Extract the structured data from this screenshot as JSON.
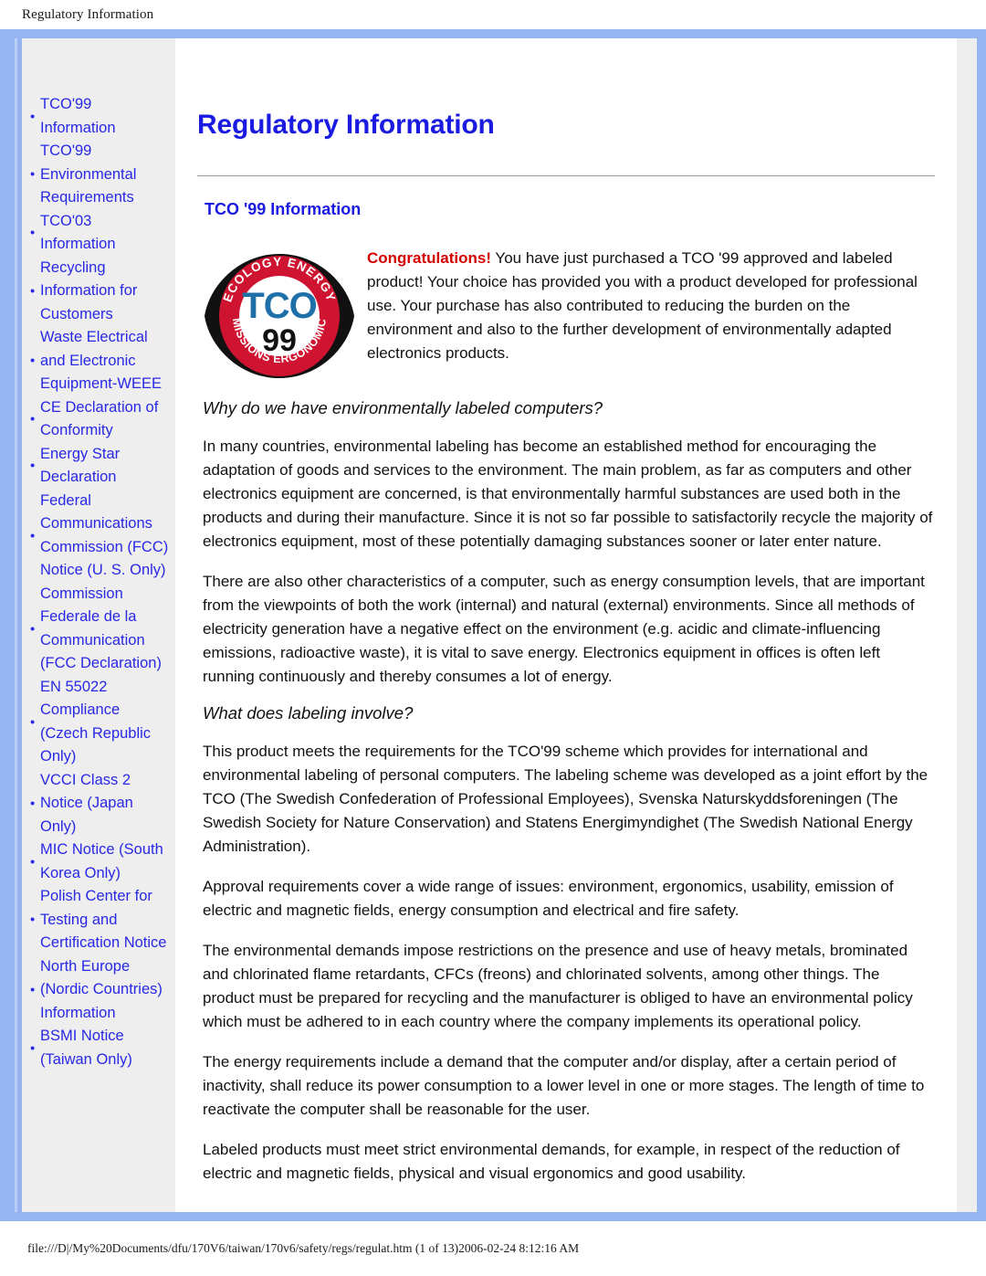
{
  "browser": {
    "header_title": "Regulatory Information",
    "footer_path": "file:///D|/My%20Documents/dfu/170V6/taiwan/170v6/safety/regs/regulat.htm (1 of 13)2006-02-24 8:12:16 AM"
  },
  "colors": {
    "frame_blue": "#96b4f0",
    "link_blue": "#2828e6",
    "heading_blue": "#1a1ae0",
    "congrats_red": "#d40000",
    "sidebar_gray": "#eeeeee"
  },
  "sidebar": {
    "items": [
      {
        "label": "TCO'99 Information"
      },
      {
        "label": "TCO'99 Environmental Requirements"
      },
      {
        "label": "TCO'03 Information"
      },
      {
        "label": "Recycling Information for Customers"
      },
      {
        "label": "Waste Electrical and Electronic Equipment-WEEE"
      },
      {
        "label": "CE Declaration of Conformity"
      },
      {
        "label": "Energy Star Declaration"
      },
      {
        "label": "Federal Communications Commission (FCC) Notice (U. S. Only)"
      },
      {
        "label": "Commission Federale de la Communication (FCC Declaration)"
      },
      {
        "label": "EN 55022 Compliance (Czech Republic Only)"
      },
      {
        "label": "VCCI Class 2 Notice (Japan Only)"
      },
      {
        "label": "MIC Notice (South Korea Only)"
      },
      {
        "label": "Polish Center for Testing and Certification Notice"
      },
      {
        "label": "North Europe (Nordic Countries) Information"
      },
      {
        "label": "BSMI Notice (Taiwan Only)"
      }
    ]
  },
  "main": {
    "title": "Regulatory Information",
    "section_title": "TCO '99 Information",
    "logo": {
      "alt": "TCO 99 certification label",
      "top_arc_text": "ECOLOGY ENERGY",
      "bottom_arc_text": "EMISSIONS ERGONOMICS",
      "center_text": "TCO",
      "year_text": "99"
    },
    "intro": {
      "congrats": "Congratulations!",
      "body": " You have just purchased a TCO '99 approved and labeled product! Your choice has provided you with a product developed for professional use. Your purchase has also contributed to reducing the burden on the environment and also to the further development of environmentally adapted electronics products."
    },
    "subhead_1": "Why do we have environmentally labeled computers?",
    "para_1": "In many countries, environmental labeling has become an established method for encouraging the adaptation of goods and services to the environment. The main problem, as far as computers and other electronics equipment are concerned, is that environmentally harmful substances are used both in the products and during their manufacture. Since it is not so far possible to satisfactorily recycle the majority of electronics equipment, most of these potentially damaging substances sooner or later enter nature.",
    "para_2": "There are also other characteristics of a computer, such as energy consumption levels, that are important from the viewpoints of both the work (internal) and natural (external) environments. Since all methods of electricity generation have a negative effect on the environment (e.g. acidic and climate-influencing emissions, radioactive waste), it is vital to save energy. Electronics equipment in offices is often left running continuously and thereby consumes a lot of energy.",
    "subhead_2": "What does labeling involve?",
    "para_3": "This product meets the requirements for the TCO'99 scheme which provides for international and environmental labeling of personal computers. The labeling scheme was developed as a joint effort by the TCO (The Swedish Confederation of Professional Employees), Svenska Naturskyddsforeningen (The Swedish Society for Nature Conservation) and Statens Energimyndighet (The Swedish National Energy Administration).",
    "para_4": "Approval requirements cover a wide range of issues: environment, ergonomics, usability, emission of electric and magnetic fields, energy consumption and electrical and fire safety.",
    "para_5": "The environmental demands impose restrictions on the presence and use of heavy metals, brominated and chlorinated flame retardants, CFCs (freons) and chlorinated solvents, among other things. The product must be prepared for recycling and the manufacturer is obliged to have an environmental policy which must be adhered to in each country where the company implements its operational policy.",
    "para_6": "The energy requirements include a demand that the computer and/or display, after a certain period of inactivity, shall reduce its power consumption to a lower level in one or more stages. The length of time to reactivate the computer shall be reasonable for the user.",
    "para_7": "Labeled products must meet strict environmental demands, for example, in respect of the reduction of electric and magnetic fields, physical and visual ergonomics and good usability."
  }
}
